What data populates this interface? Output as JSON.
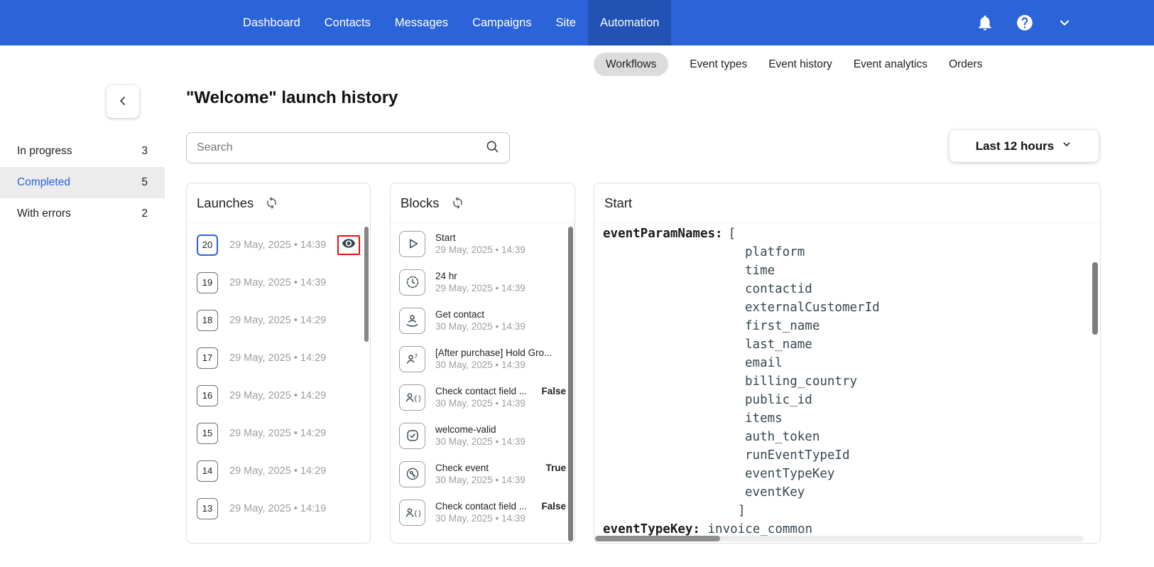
{
  "topnav": {
    "active": "Automation",
    "items": [
      {
        "label": "Dashboard"
      },
      {
        "label": "Contacts"
      },
      {
        "label": "Messages"
      },
      {
        "label": "Campaigns"
      },
      {
        "label": "Site"
      },
      {
        "label": "Automation"
      }
    ],
    "right_icons": [
      "bell-icon",
      "help-icon",
      "chevron-down-icon"
    ]
  },
  "subnav": {
    "active": "Workflows",
    "items": [
      {
        "label": "Workflows"
      },
      {
        "label": "Event types"
      },
      {
        "label": "Event history"
      },
      {
        "label": "Event analytics"
      },
      {
        "label": "Orders"
      }
    ]
  },
  "page": {
    "title": "\"Welcome\" launch history"
  },
  "sidebar": {
    "items": [
      {
        "label": "In progress",
        "count": "3",
        "selected": false
      },
      {
        "label": "Completed",
        "count": "5",
        "selected": true
      },
      {
        "label": "With errors",
        "count": "2",
        "selected": false
      }
    ]
  },
  "search": {
    "placeholder": "Search"
  },
  "time_filter": {
    "label": "Last 12 hours"
  },
  "launches": {
    "title": "Launches",
    "items": [
      {
        "number": "20",
        "date": "29 May, 2025 • 14:39",
        "selected": true
      },
      {
        "number": "19",
        "date": "29 May, 2025 • 14:39",
        "selected": false
      },
      {
        "number": "18",
        "date": "29 May, 2025 • 14:29",
        "selected": false
      },
      {
        "number": "17",
        "date": "29 May, 2025 • 14:29",
        "selected": false
      },
      {
        "number": "16",
        "date": "29 May, 2025 • 14:29",
        "selected": false
      },
      {
        "number": "15",
        "date": "29 May, 2025 • 14:29",
        "selected": false
      },
      {
        "number": "14",
        "date": "29 May, 2025 • 14:29",
        "selected": false
      },
      {
        "number": "13",
        "date": "29 May, 2025 • 14:19",
        "selected": false
      }
    ]
  },
  "blocks": {
    "title": "Blocks",
    "items": [
      {
        "icon": "start-icon",
        "title": "Start",
        "date": "29 May, 2025 • 14:39",
        "result": ""
      },
      {
        "icon": "timer-icon",
        "title": "24 hr",
        "date": "29 May, 2025 • 14:39",
        "result": ""
      },
      {
        "icon": "get-contact-icon",
        "title": "Get contact",
        "date": "30 May, 2025 • 14:39",
        "result": ""
      },
      {
        "icon": "hold-group-icon",
        "title": "[After purchase] Hold Gro...",
        "date": "30 May, 2025 • 14:39",
        "result": ""
      },
      {
        "icon": "contact-field-icon",
        "title": "Check contact field ...",
        "date": "30 May, 2025 • 14:39",
        "result": "False"
      },
      {
        "icon": "check-icon",
        "title": "welcome-valid",
        "date": "30 May, 2025 • 14:39",
        "result": ""
      },
      {
        "icon": "check-event-icon",
        "title": "Check event",
        "date": "30 May, 2025 • 14:39",
        "result": "True"
      },
      {
        "icon": "contact-field-icon",
        "title": "Check contact field ...",
        "date": "30 May, 2025 • 14:39",
        "result": "False"
      }
    ]
  },
  "detail": {
    "title": "Start",
    "code": {
      "key1": "eventParamNames:",
      "open_bracket": "[",
      "params": [
        "platform",
        "time",
        "contactid",
        "externalCustomerId",
        "first_name",
        "last_name",
        "email",
        "billing_country",
        "public_id",
        "items",
        "auth_token",
        "runEventTypeId",
        "eventTypeKey",
        "eventKey"
      ],
      "close_bracket": "]",
      "key2": "eventTypeKey:",
      "value2": "invoice_common"
    }
  }
}
